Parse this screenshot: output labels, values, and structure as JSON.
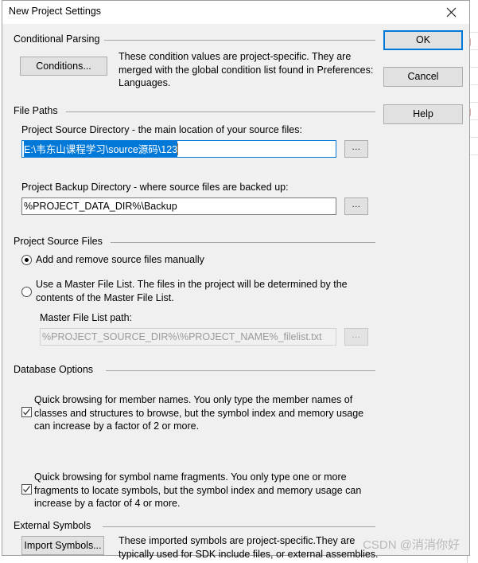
{
  "window": {
    "title": "New Project Settings",
    "close_icon": "close-icon"
  },
  "action_buttons": {
    "ok": "OK",
    "cancel": "Cancel",
    "help": "Help"
  },
  "groups": {
    "conditional_parsing": {
      "label": "Conditional Parsing",
      "conditions_button": "Conditions...",
      "description": "These condition values are project-specific.  They are merged with the global condition list found in Preferences: Languages."
    },
    "file_paths": {
      "label": "File Paths",
      "source_dir_label": "Project Source Directory - the main location of your source files:",
      "source_dir_value": "E:\\韦东山课程学习\\source源码\\123",
      "source_dir_browse": "...",
      "backup_dir_label": "Project Backup Directory - where source files are backed up:",
      "backup_dir_value": "%PROJECT_DATA_DIR%\\Backup",
      "backup_dir_browse": "..."
    },
    "project_source_files": {
      "label": "Project Source Files",
      "radio_manual": "Add and remove source files manually",
      "radio_master": "Use a Master File List. The files in the project will be determined by the\ncontents of the Master File List.",
      "master_path_label": "Master File List path:",
      "master_path_value": "%PROJECT_SOURCE_DIR%\\%PROJECT_NAME%_filelist.txt",
      "master_path_browse": "..."
    },
    "database_options": {
      "label": "Database Options",
      "option_member_names": "Quick browsing for member names.  You only type the member names of\nclasses and structures to browse, but the symbol index and memory usage\ncan increase by a factor of 2 or more.",
      "option_name_fragments": "Quick browsing for symbol name fragments.  You only type one or more\nfragments to locate symbols, but the symbol index and memory usage can\nincrease by a factor of 4 or more."
    },
    "external_symbols": {
      "label": "External Symbols",
      "import_button": "Import Symbols...",
      "description": "These imported symbols are project-specific.They are\ntypically used for SDK include files, or external assemblies."
    }
  },
  "watermark": "CSDN @消消你好",
  "colors": {
    "accent": "#0078d7",
    "dialog_bg": "#f0f0f0",
    "button_bg": "#e1e1e1",
    "selection": "#0078d7",
    "caret": "#c47a33"
  }
}
